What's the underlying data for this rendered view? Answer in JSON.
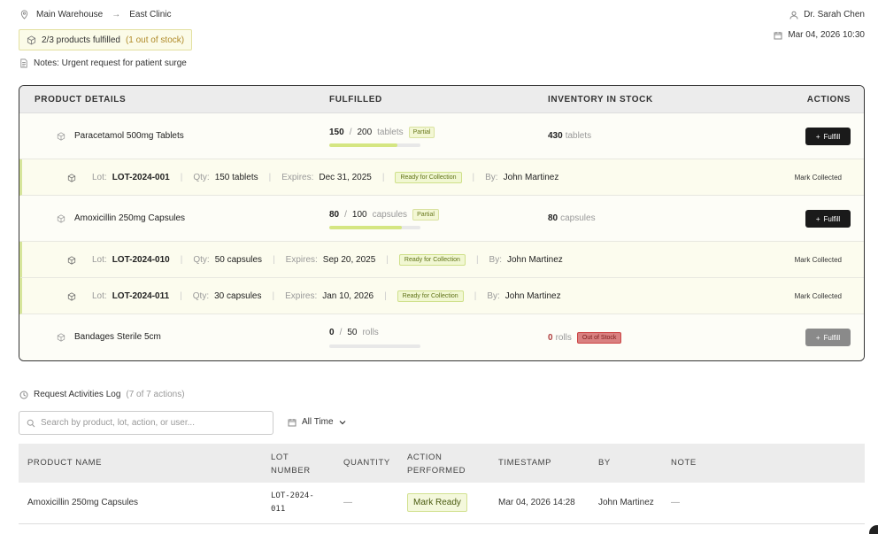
{
  "header": {
    "from": "Main Warehouse",
    "to": "East Clinic",
    "fulfilled_summary": "2/3 products fulfilled",
    "out_of_stock_note": "(1 out of stock)",
    "notes": "Notes: Urgent request for patient surge",
    "user": "Dr. Sarah Chen",
    "datetime": "Mar 04, 2026 10:30"
  },
  "products_table": {
    "columns": [
      "PRODUCT DETAILS",
      "FULFILLED",
      "INVENTORY IN STOCK",
      "ACTIONS"
    ],
    "products": [
      {
        "name": "Paracetamol 500mg Tablets",
        "fulfilled": "150",
        "requested": "200",
        "unit": "tablets",
        "status": "Partial",
        "progress": 0.75,
        "stock": "430",
        "stock_unit": "tablets",
        "action": "Fulfill",
        "lots": [
          {
            "lot_label": "Lot:",
            "lot": "LOT-2024-001",
            "qty_label": "Qty:",
            "qty": "150 tablets",
            "exp_label": "Expires:",
            "expires": "Dec 31, 2025",
            "status": "Ready for Collection",
            "by_label": "By:",
            "by": "John Martinez",
            "action": "Mark Collected"
          }
        ]
      },
      {
        "name": "Amoxicillin 250mg Capsules",
        "fulfilled": "80",
        "requested": "100",
        "unit": "capsules",
        "status": "Partial",
        "progress": 0.8,
        "stock": "80",
        "stock_unit": "capsules",
        "action": "Fulfill",
        "lots": [
          {
            "lot_label": "Lot:",
            "lot": "LOT-2024-010",
            "qty_label": "Qty:",
            "qty": "50 capsules",
            "exp_label": "Expires:",
            "expires": "Sep 20, 2025",
            "status": "Ready for Collection",
            "by_label": "By:",
            "by": "John Martinez",
            "action": "Mark Collected"
          },
          {
            "lot_label": "Lot:",
            "lot": "LOT-2024-011",
            "qty_label": "Qty:",
            "qty": "30 capsules",
            "exp_label": "Expires:",
            "expires": "Jan 10, 2026",
            "status": "Ready for Collection",
            "by_label": "By:",
            "by": "John Martinez",
            "action": "Mark Collected"
          }
        ]
      },
      {
        "name": "Bandages Sterile 5cm",
        "fulfilled": "0",
        "requested": "50",
        "unit": "rolls",
        "progress": 0,
        "stock": "0",
        "stock_unit": "rolls",
        "stock_badge": "Out of Stock",
        "action": "Fulfill"
      }
    ]
  },
  "activities": {
    "title": "Request Activities Log",
    "count": "(7 of 7 actions)",
    "search_placeholder": "Search by product, lot, action, or user...",
    "filter": "All Time",
    "columns": [
      "PRODUCT NAME",
      "LOT NUMBER",
      "QUANTITY",
      "ACTION PERFORMED",
      "TIMESTAMP",
      "BY",
      "NOTE"
    ],
    "rows": [
      {
        "product": "Amoxicillin 250mg Capsules",
        "lot": "LOT-2024-011",
        "quantity": "—",
        "action": "Mark Ready",
        "timestamp": "Mar 04, 2026 14:28",
        "by": "John Martinez",
        "note": "—"
      }
    ]
  },
  "icons": {
    "location": "map-pin-icon",
    "arrow": "arrow-right-icon",
    "user": "user-icon",
    "calendar": "calendar-icon",
    "package": "package-icon",
    "file": "file-icon",
    "history": "history-icon",
    "search": "search-icon",
    "chevron": "chevron-down-icon"
  },
  "colors": {
    "accent": "#d5e682",
    "dark_button": "#1a1a1a",
    "out_of_stock": "#d98080"
  }
}
